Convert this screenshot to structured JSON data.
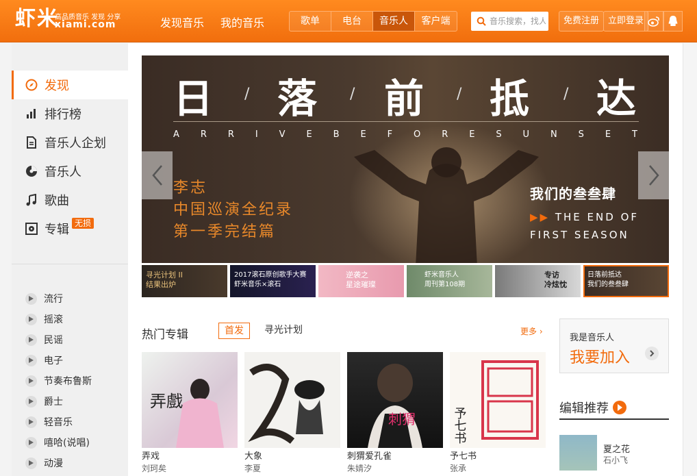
{
  "header": {
    "logo_main": "虾米",
    "logo_tagline": "高品质音乐 发现 分享",
    "logo_domain": "xiami.com",
    "nav": [
      "发现音乐",
      "我的音乐"
    ],
    "categories": [
      "歌单",
      "电台",
      "音乐人",
      "客户端"
    ],
    "active_category": "音乐人",
    "search_placeholder": "音乐搜索，找人...",
    "register_label": "免费注册",
    "login_label": "立即登录",
    "colors": {
      "brand": "#f26b0d",
      "header_bg": "#ff7f16"
    }
  },
  "sidebar": {
    "items": [
      {
        "label": "发现",
        "icon": "compass-icon"
      },
      {
        "label": "排行榜",
        "icon": "bar-chart-icon"
      },
      {
        "label": "音乐人企划",
        "icon": "document-icon"
      },
      {
        "label": "音乐人",
        "icon": "vinyl-icon"
      },
      {
        "label": "歌曲",
        "icon": "music-note-icon"
      },
      {
        "label": "专辑",
        "icon": "album-icon",
        "badge": "无损"
      }
    ],
    "genres": [
      "流行",
      "摇滚",
      "民谣",
      "电子",
      "节奏布鲁斯",
      "爵士",
      "轻音乐",
      "嘻哈(说唱)",
      "动漫"
    ]
  },
  "banner": {
    "title_chars": [
      "日",
      "落",
      "前",
      "抵",
      "达"
    ],
    "subtitle_en": [
      "A",
      "R",
      "R",
      "I",
      "V",
      "E",
      "B",
      "E",
      "F",
      "O",
      "R",
      "E",
      "S",
      "U",
      "N",
      "S",
      "E",
      "T"
    ],
    "left_lines": [
      "李志",
      "中国巡演全纪录",
      "第一季完结篇"
    ],
    "right_title": "我们的叁叁肆",
    "right_en_1": "THE END OF",
    "right_en_2": "FIRST SEASON",
    "right_arrows": "▶▶"
  },
  "thumbs": [
    {
      "text": "寻光计划 II\n结果出炉"
    },
    {
      "text": "2017滚石原创歌手大赛\n虾米音乐×滚石"
    },
    {
      "text": "逆袭之\n星途璀璨"
    },
    {
      "text": "虾米音乐人\n周刊第108期"
    },
    {
      "text": "专访\n冷炫忱"
    },
    {
      "text": "日落前抵达\n我们的叁叁肆"
    }
  ],
  "hot_albums": {
    "title": "热门专辑",
    "tabs": [
      "首发",
      "寻光计划"
    ],
    "more": "更多",
    "albums": [
      {
        "name": "弄戏",
        "artist": "刘珂矣"
      },
      {
        "name": "大象",
        "artist": "李夏"
      },
      {
        "name": "刺猬爱孔雀",
        "artist": "朱婧汐"
      },
      {
        "name": "予七书",
        "artist": "张承"
      }
    ]
  },
  "join": {
    "line1": "我是音乐人",
    "line2": "我要加入"
  },
  "editor": {
    "title": "编辑推荐",
    "item": {
      "title": "夏之花",
      "artist": "石小飞"
    }
  }
}
